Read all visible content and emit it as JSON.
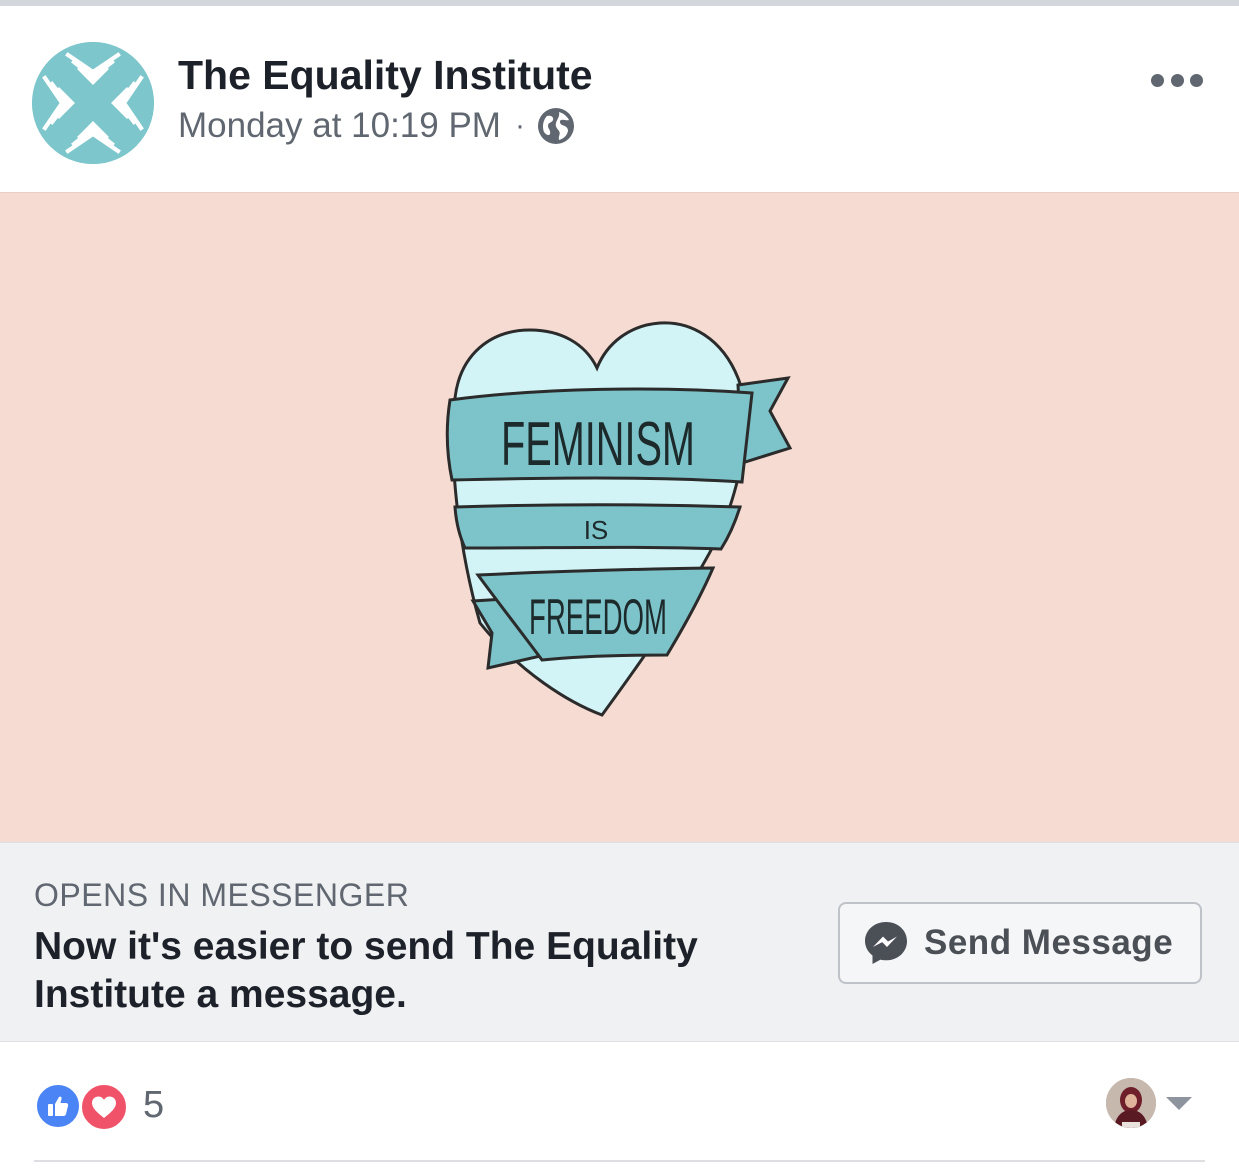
{
  "post": {
    "page_name": "The Equality Institute",
    "timestamp": "Monday at 10:19 PM",
    "separator": "·",
    "privacy_icon": "globe-icon",
    "more_icon": "more-horizontal-icon"
  },
  "media": {
    "line1": "FEMINISM",
    "line2": "IS",
    "line3": "FREEDOM",
    "background_color": "#f5dbd2",
    "heart_color": "#d2f4f7",
    "ribbon_color": "#7cc3ca"
  },
  "cta": {
    "eyebrow": "OPENS IN MESSENGER",
    "headline": "Now it's easier to send The Equality Institute a message.",
    "button_label": "Send Message",
    "button_icon": "messenger-icon"
  },
  "reactions": {
    "types": [
      "like-icon",
      "love-icon"
    ],
    "count": "5",
    "like_color": "#4a84f5",
    "love_color": "#f0526a"
  }
}
